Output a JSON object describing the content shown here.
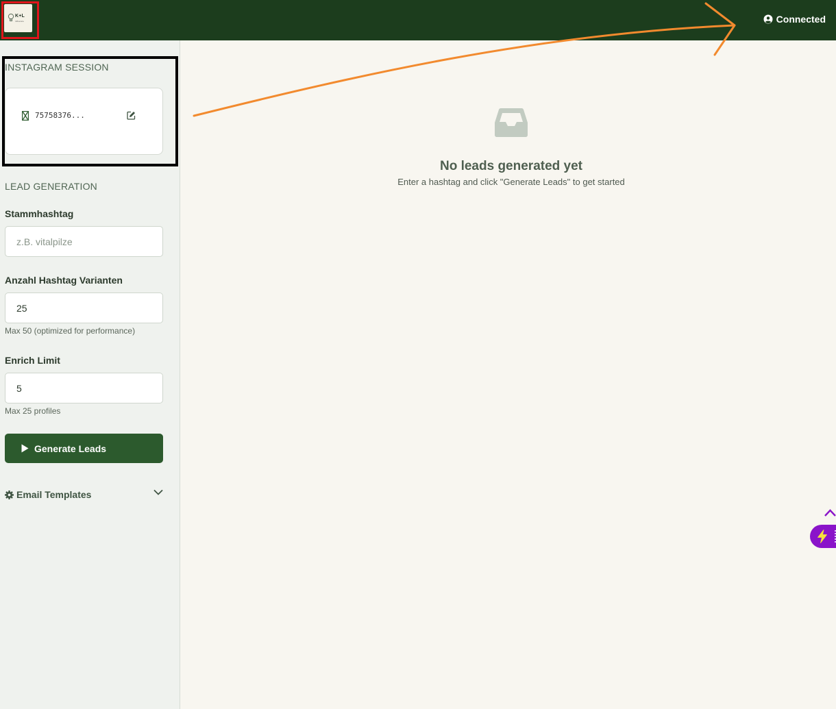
{
  "header": {
    "logo_text": "K+L",
    "logo_subtext": "influence",
    "status_label": "Connected"
  },
  "sidebar": {
    "session": {
      "title": "INSTAGRAM SESSION",
      "session_id": "75758376..."
    },
    "lead_generation": {
      "title": "LEAD GENERATION",
      "hashtag_label": "Stammhashtag",
      "hashtag_placeholder": "z.B. vitalpilze",
      "hashtag_value": "",
      "variants_label": "Anzahl Hashtag Varianten",
      "variants_value": "25",
      "variants_help": "Max 50 (optimized for performance)",
      "enrich_label": "Enrich Limit",
      "enrich_value": "5",
      "enrich_help": "Max 25 profiles",
      "generate_button": "Generate Leads"
    },
    "email_templates_label": "Email Templates"
  },
  "main": {
    "empty_title": "No leads generated yet",
    "empty_subtitle": "Enter a hashtag and click \"Generate Leads\" to get started"
  },
  "icons": {
    "logo": "lightbulb-icon",
    "status": "user-circle-icon",
    "session": "hourglass-icon",
    "edit": "edit-icon",
    "play": "play-icon",
    "settings": "gear-icon",
    "expand": "chevron-down-icon",
    "empty": "inbox-icon",
    "assistant": "lightning-icon",
    "collapse": "chevron-up-icon"
  },
  "colors": {
    "header": "#1c3d1d",
    "primary_button": "#2c5a2d",
    "sidebar": "#eff2ee",
    "main": "#f8f6f0",
    "annotation_arrow": "#f28a2e",
    "annotation_box_red": "#e0151b",
    "annotation_box_black": "#000000",
    "assistant_fab": "#8a14c9"
  }
}
